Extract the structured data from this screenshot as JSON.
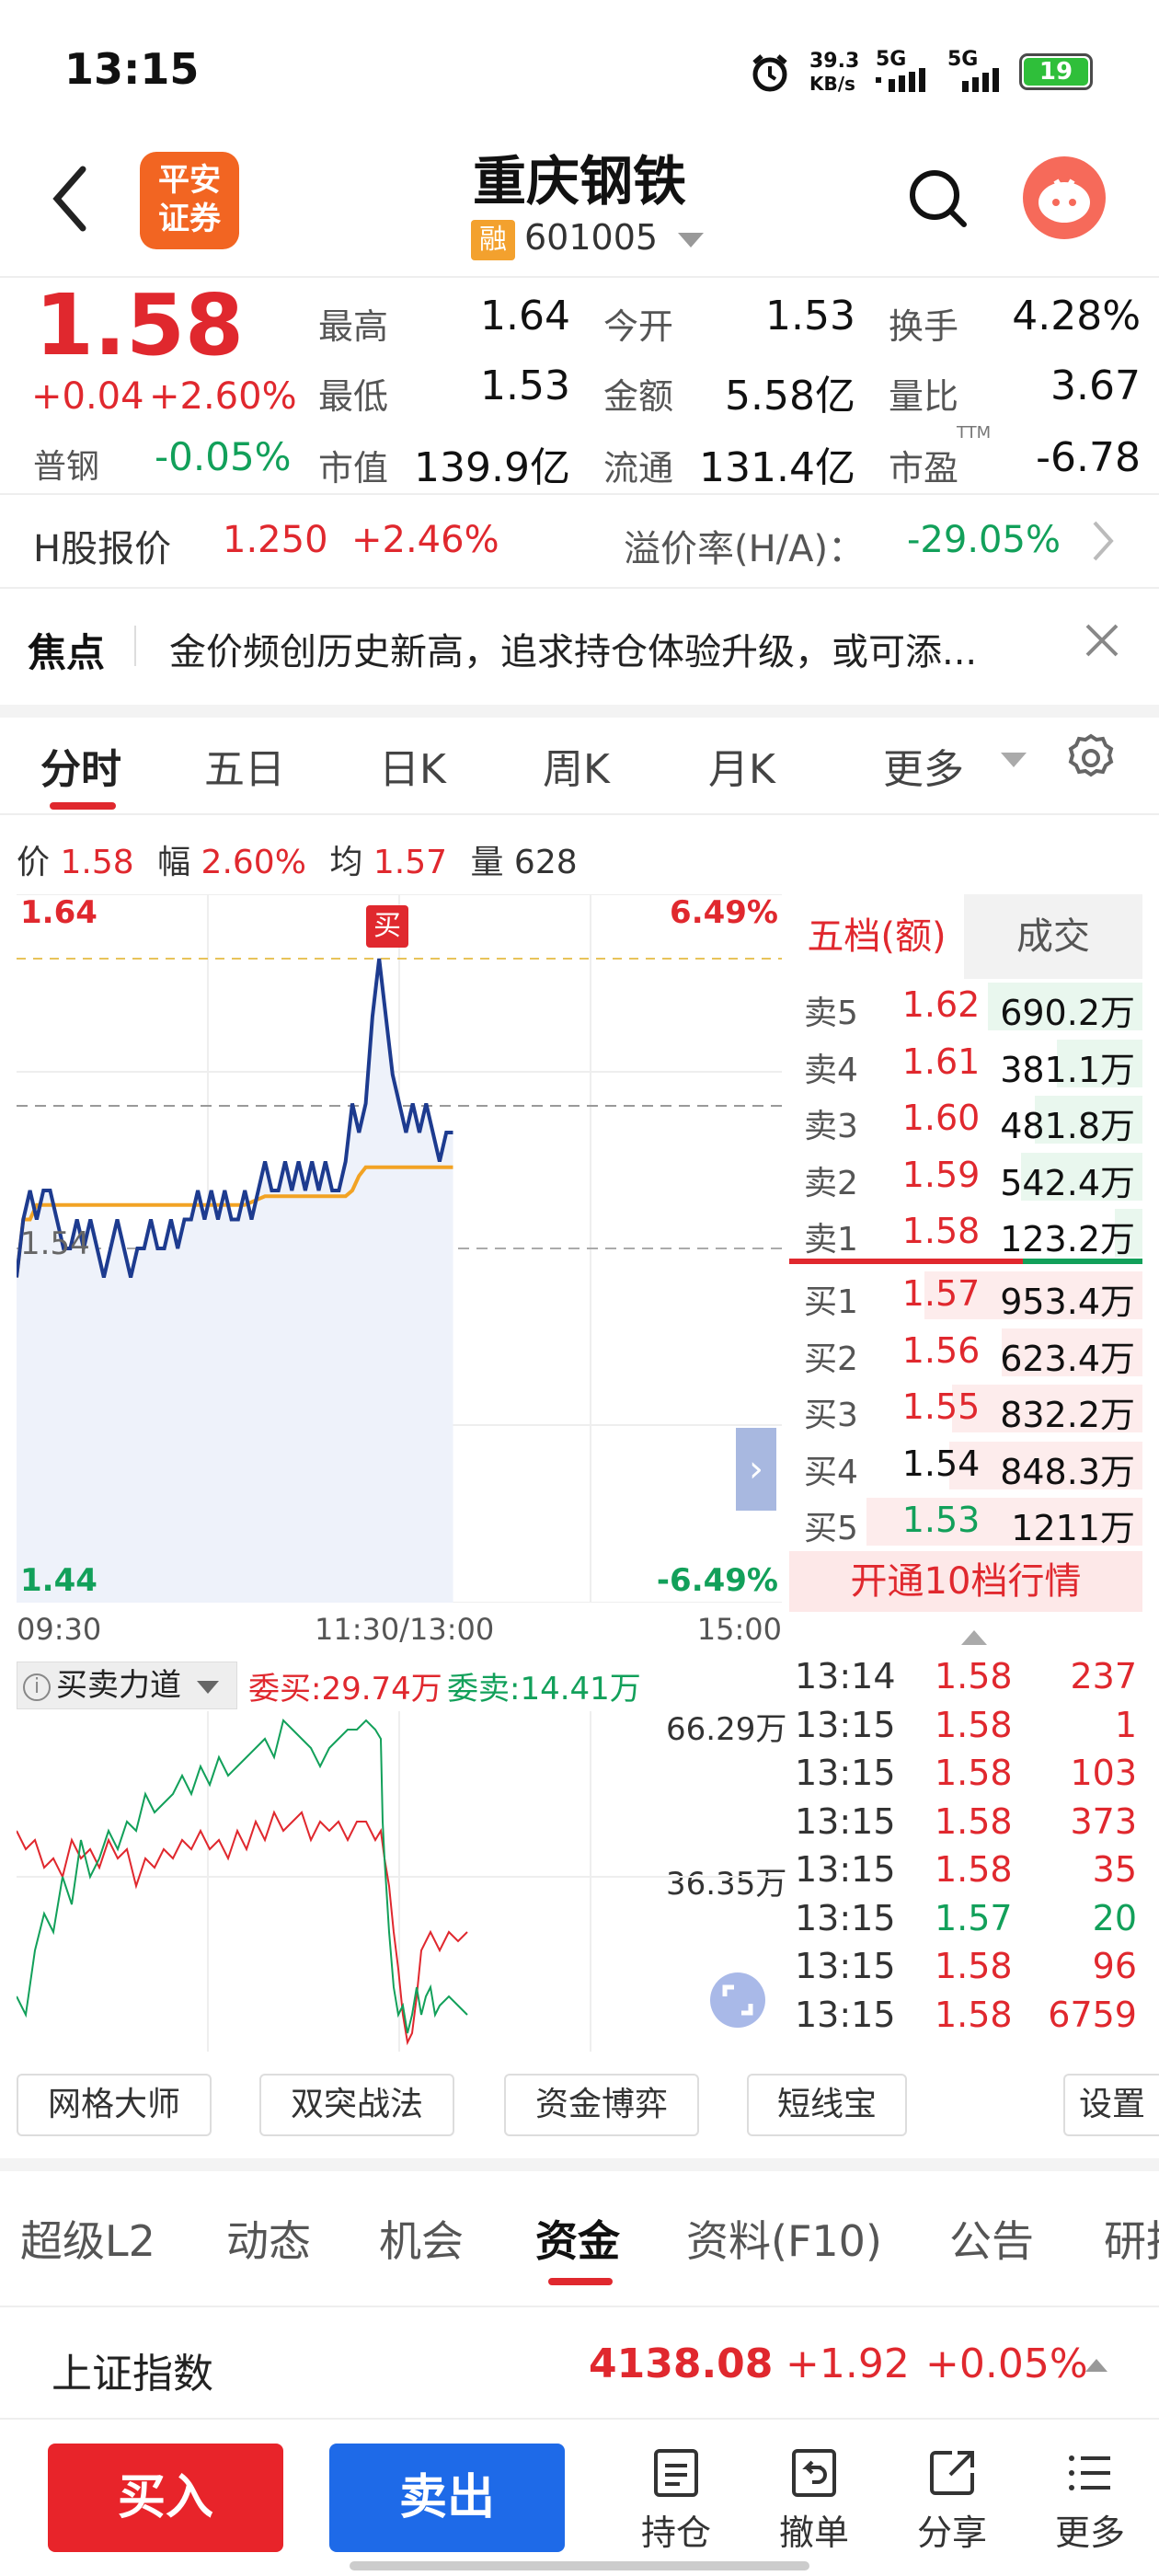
{
  "status_bar": {
    "time": "13:15",
    "net_speed_value": "39.3",
    "net_speed_unit": "KB/s",
    "sim1": "5G",
    "sim2": "5G",
    "battery": "19"
  },
  "header": {
    "broker_logo_line1": "平安",
    "broker_logo_line2": "证券",
    "stock_name": "重庆钢铁",
    "margin_badge": "融",
    "stock_code": "601005"
  },
  "quote": {
    "price": "1.58",
    "change": "+0.04",
    "change_pct": "+2.60%",
    "sector_label": "普钢",
    "sector_change": "-0.05%",
    "high_label": "最高",
    "high": "1.64",
    "low_label": "最低",
    "low": "1.53",
    "mcap_label": "市值",
    "mcap": "139.9亿",
    "open_label": "今开",
    "open": "1.53",
    "amount_label": "金额",
    "amount": "5.58亿",
    "float_label": "流通",
    "float": "131.4亿",
    "turnover_label": "换手",
    "turnover": "4.28%",
    "vol_ratio_label": "量比",
    "vol_ratio": "3.67",
    "pe_label": "市盈",
    "pe_sup": "TTM",
    "pe": "-6.78"
  },
  "hshare": {
    "label": "H股报价",
    "price": "1.250",
    "change": "+2.46%",
    "premium_label": "溢价率(H/A)：",
    "premium": "-29.05%"
  },
  "focus": {
    "label": "焦点",
    "text": "金价频创历史新高，追求持仓体验升级，或可添..."
  },
  "chart_tabs": [
    "分时",
    "五日",
    "日K",
    "周K",
    "月K",
    "更多"
  ],
  "chart_info": {
    "price_label": "价",
    "price": "1.58",
    "amp_label": "幅",
    "amp": "2.60%",
    "avg_label": "均",
    "avg": "1.57",
    "vol_label": "量",
    "vol": "628"
  },
  "chart_labels": {
    "top_price": "1.64",
    "top_pct": "6.49%",
    "mid_price": "1.54",
    "bottom_price": "1.44",
    "bottom_pct": "-6.49%",
    "buy_marker": "买",
    "t_start": "09:30",
    "t_mid": "11:30/13:00",
    "t_end": "15:00"
  },
  "chart_data": {
    "type": "line",
    "ylim": [
      1.44,
      1.64
    ],
    "series": [
      {
        "values": [
          1.53,
          1.55,
          1.56,
          1.55,
          1.56,
          1.56,
          1.55,
          1.54,
          1.54,
          1.55,
          1.54,
          1.55,
          1.54,
          1.53,
          1.54,
          1.55,
          1.54,
          1.53,
          1.54,
          1.54,
          1.55,
          1.54,
          1.54,
          1.55,
          1.54,
          1.55,
          1.55,
          1.56,
          1.55,
          1.56,
          1.55,
          1.56,
          1.55,
          1.55,
          1.56,
          1.55,
          1.56,
          1.57,
          1.56,
          1.56,
          1.57,
          1.56,
          1.57,
          1.56,
          1.57,
          1.56,
          1.57,
          1.56,
          1.56,
          1.57,
          1.59,
          1.58,
          1.59,
          1.62,
          1.64,
          1.62,
          1.6,
          1.59,
          1.58,
          1.59,
          1.58,
          1.59,
          1.58,
          1.57,
          1.58,
          1.58
        ]
      },
      {
        "values": [
          1.53,
          1.55,
          1.55,
          1.555,
          1.555,
          1.555,
          1.555,
          1.555,
          1.555,
          1.555,
          1.555,
          1.555,
          1.555,
          1.555,
          1.555,
          1.555,
          1.555,
          1.555,
          1.555,
          1.555,
          1.555,
          1.555,
          1.555,
          1.555,
          1.555,
          1.555,
          1.555,
          1.555,
          1.555,
          1.555,
          1.555,
          1.555,
          1.555,
          1.555,
          1.555,
          1.556,
          1.557,
          1.558,
          1.558,
          1.558,
          1.558,
          1.558,
          1.558,
          1.558,
          1.558,
          1.558,
          1.558,
          1.558,
          1.558,
          1.558,
          1.56,
          1.565,
          1.568,
          1.568,
          1.568,
          1.568,
          1.568,
          1.568,
          1.568,
          1.568,
          1.568,
          1.568,
          1.568,
          1.568,
          1.568,
          1.568
        ]
      }
    ]
  },
  "orderbook": {
    "tab_active": "五档(额)",
    "tab_other": "成交",
    "asks": [
      {
        "label": "卖5",
        "price": "1.62",
        "amount": "690.2万",
        "level": 0.56
      },
      {
        "label": "卖4",
        "price": "1.61",
        "amount": "381.1万",
        "level": 0.31
      },
      {
        "label": "卖3",
        "price": "1.60",
        "amount": "481.8万",
        "level": 0.39
      },
      {
        "label": "卖2",
        "price": "1.59",
        "amount": "542.4万",
        "level": 0.44
      },
      {
        "label": "卖1",
        "price": "1.58",
        "amount": "123.2万",
        "level": 0.1
      }
    ],
    "bids": [
      {
        "label": "买1",
        "price": "1.57",
        "amount": "953.4万",
        "level": 0.79
      },
      {
        "label": "买2",
        "price": "1.56",
        "amount": "623.4万",
        "level": 0.51
      },
      {
        "label": "买3",
        "price": "1.55",
        "amount": "832.2万",
        "level": 0.69
      },
      {
        "label": "买4",
        "price": "1.54",
        "amount": "848.3万",
        "level": 0.7
      },
      {
        "label": "买5",
        "price": "1.53",
        "amount": "1211万",
        "level": 1.0
      }
    ],
    "level10_label": "开通10档行情"
  },
  "force": {
    "selector": "买卖力道",
    "buy_label": "委买:29.74万",
    "sell_label": "委卖:14.41万",
    "top_val": "66.29万",
    "mid_val": "36.35万"
  },
  "trades": [
    {
      "time": "13:14",
      "price": "1.58",
      "vol": "237",
      "dir": "up"
    },
    {
      "time": "13:15",
      "price": "1.58",
      "vol": "1",
      "dir": "up"
    },
    {
      "time": "13:15",
      "price": "1.58",
      "vol": "103",
      "dir": "up"
    },
    {
      "time": "13:15",
      "price": "1.58",
      "vol": "373",
      "dir": "up"
    },
    {
      "time": "13:15",
      "price": "1.58",
      "vol": "35",
      "dir": "up"
    },
    {
      "time": "13:15",
      "price": "1.57",
      "vol": "20",
      "dir": "down"
    },
    {
      "time": "13:15",
      "price": "1.58",
      "vol": "96",
      "dir": "up"
    },
    {
      "time": "13:15",
      "price": "1.58",
      "vol": "6759",
      "dir": "up"
    }
  ],
  "tools": [
    "网格大师",
    "双突战法",
    "资金博弈",
    "短线宝",
    "设置"
  ],
  "info_tabs": [
    "超级L2",
    "动态",
    "机会",
    "资金",
    "资料(F10)",
    "公告",
    "研报"
  ],
  "index_bar": {
    "name": "上证指数",
    "value": "4138.08",
    "change": "+1.92",
    "pct": "+0.05%"
  },
  "bottom_bar": {
    "buy": "买入",
    "sell": "卖出",
    "position": "持仓",
    "cancel": "撤单",
    "share": "分享",
    "more": "更多"
  },
  "colors": {
    "up": "#e0282e",
    "down": "#12a05a",
    "price_line": "#1d3b8f",
    "avg_line": "#f2a324",
    "sell_btn": "#1e6ae8",
    "buy_btn": "#e8242a"
  }
}
